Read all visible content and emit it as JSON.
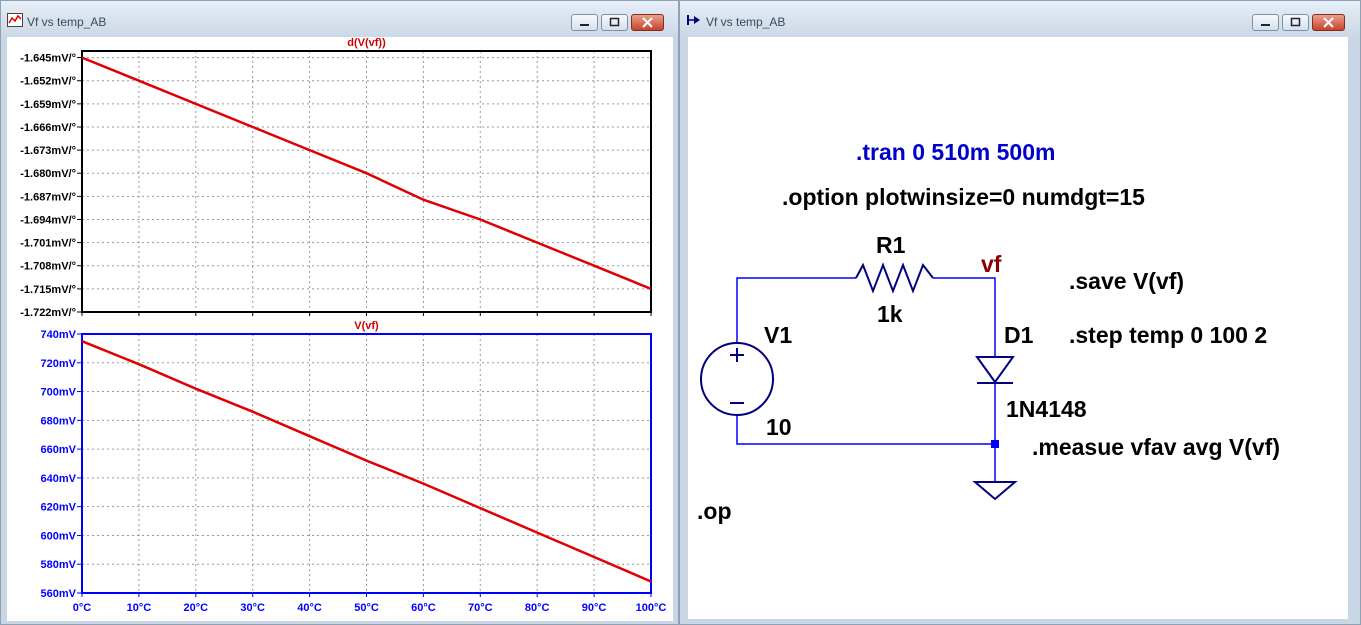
{
  "left_window": {
    "title": "Vf vs temp_AB",
    "top_pane": {
      "title": "d(V(vf))",
      "y_ticks": [
        "-1.645mV/°",
        "-1.652mV/°",
        "-1.659mV/°",
        "-1.666mV/°",
        "-1.673mV/°",
        "-1.680mV/°",
        "-1.687mV/°",
        "-1.694mV/°",
        "-1.701mV/°",
        "-1.708mV/°",
        "-1.715mV/°",
        "-1.722mV/°"
      ]
    },
    "bottom_pane": {
      "title": "V(vf)",
      "y_ticks": [
        "740mV",
        "720mV",
        "700mV",
        "680mV",
        "660mV",
        "640mV",
        "620mV",
        "600mV",
        "580mV",
        "560mV"
      ],
      "x_ticks": [
        "0°C",
        "10°C",
        "20°C",
        "30°C",
        "40°C",
        "50°C",
        "60°C",
        "70°C",
        "80°C",
        "90°C",
        "100°C"
      ]
    },
    "colors": {
      "trace": "#e00000",
      "top_frame": "#000000",
      "bottom_frame": "#0000ff",
      "grid": "#9a9a9a"
    }
  },
  "right_window": {
    "title": "Vf vs temp_AB",
    "directives": {
      "tran": ".tran 0 510m 500m",
      "option": ".option plotwinsize=0 numdgt=15",
      "save": ".save V(vf)",
      "step": ".step temp 0 100 2",
      "measure": ".measue vfav avg V(vf)",
      "op": ".op"
    },
    "components": {
      "r1_name": "R1",
      "r1_value": "1k",
      "d1_name": "D1",
      "d1_value": "1N4148",
      "v1_name": "V1",
      "v1_value": "10",
      "net_label": "vf"
    },
    "colors": {
      "wire": "#0000ff",
      "symbol": "#000080",
      "net_label": "#8b0000",
      "tran": "#0000cc"
    }
  },
  "chart_data": [
    {
      "type": "line",
      "title": "d(V(vf))",
      "x": [
        0,
        10,
        20,
        30,
        40,
        50,
        60,
        70,
        80,
        90,
        100
      ],
      "values": [
        -1.645,
        -1.652,
        -1.659,
        -1.666,
        -1.673,
        -1.68,
        -1.688,
        -1.694,
        -1.701,
        -1.708,
        -1.715
      ],
      "ylim": [
        -1.722,
        -1.643
      ],
      "xlim": [
        0,
        100
      ],
      "grid": true
    },
    {
      "type": "line",
      "title": "V(vf)",
      "x": [
        0,
        10,
        20,
        30,
        40,
        50,
        60,
        70,
        80,
        90,
        100
      ],
      "values": [
        735,
        719,
        702,
        686,
        669,
        652,
        636,
        619,
        602,
        585,
        568
      ],
      "ylim": [
        560,
        740
      ],
      "xlim": [
        0,
        100
      ],
      "grid": true
    }
  ]
}
